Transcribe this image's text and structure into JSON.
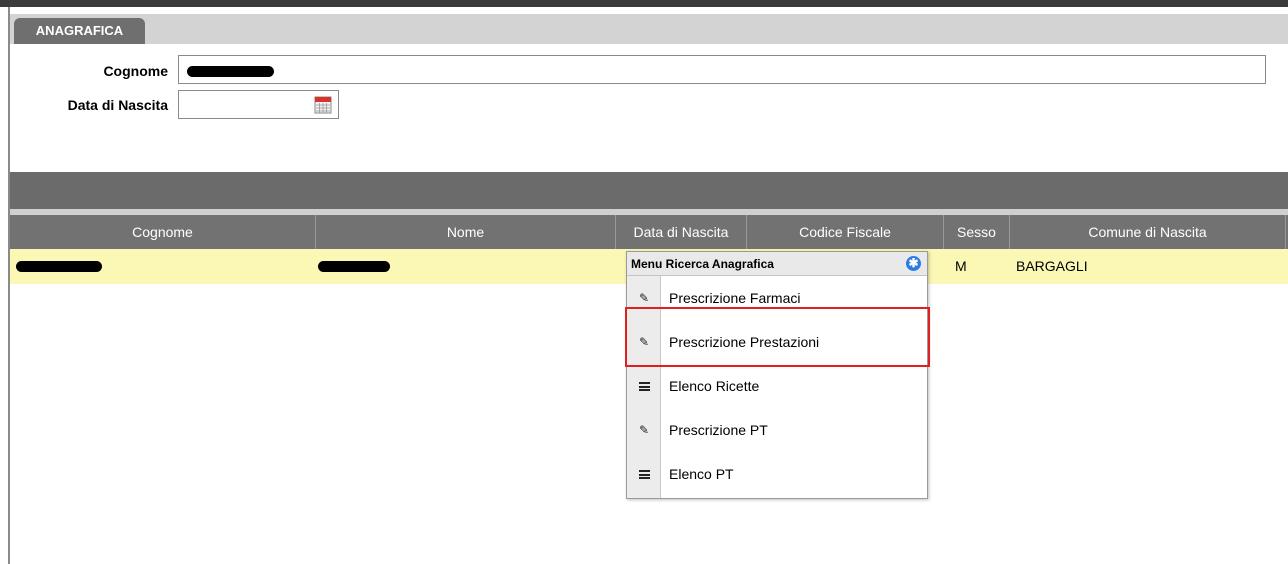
{
  "tab": {
    "label": "ANAGRAFICA"
  },
  "form": {
    "cognome_label": "Cognome",
    "data_nascita_label": "Data di Nascita",
    "data_nascita_value": ""
  },
  "table": {
    "headers": [
      "Cognome",
      "Nome",
      "Data di Nascita",
      "Codice Fiscale",
      "Sesso",
      "Comune di Nascita"
    ],
    "rows": [
      {
        "cognome": "",
        "nome": "",
        "data_nascita": "",
        "codice_fiscale": "",
        "sesso": "M",
        "comune": "BARGAGLI"
      }
    ]
  },
  "menu": {
    "title": "Menu Ricerca Anagrafica",
    "items": [
      {
        "label": "Prescrizione Farmaci",
        "icon": "pencil-icon"
      },
      {
        "label": "Prescrizione Prestazioni",
        "icon": "pencil-icon"
      },
      {
        "label": "Elenco Ricette",
        "icon": "list-icon"
      },
      {
        "label": "Prescrizione PT",
        "icon": "pencil-icon"
      },
      {
        "label": "Elenco PT",
        "icon": "list-icon"
      }
    ]
  },
  "colors": {
    "highlight_border": "#e02020",
    "row_selected": "#fbf7b4",
    "header_bg": "#727272",
    "gear_blue": "#2a7de1"
  }
}
